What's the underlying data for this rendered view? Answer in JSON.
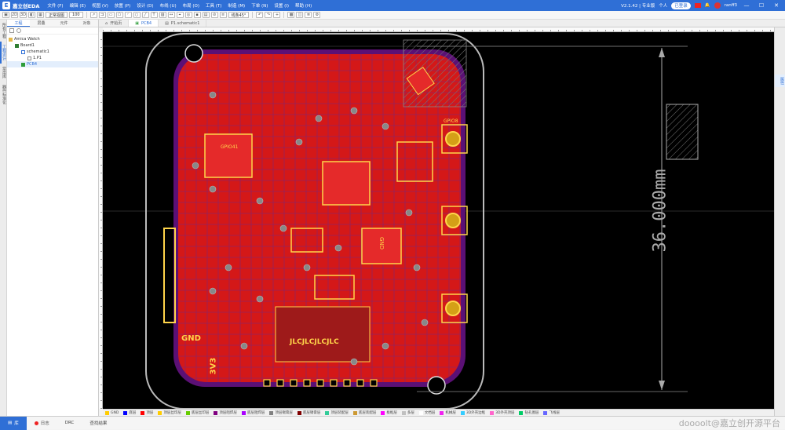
{
  "app": {
    "name": "嘉立创EDA",
    "menu": [
      "文件 (F)",
      "编辑 (E)",
      "视图 (V)",
      "放置 (P)",
      "设计 (D)",
      "布线 (U)",
      "布局 (O)",
      "工具 (T)",
      "制造 (M)",
      "下单 (N)",
      "设置 (I)",
      "帮助 (H)"
    ],
    "version": "V2.1.42 | 专业版",
    "mode": "个人",
    "cloud": "已登录",
    "username": "ranff3"
  },
  "toolbar": {
    "view_select": "正常视图",
    "zoom_select": "100",
    "angle_select": "线条45°"
  },
  "left_panel": {
    "vertical_tabs": [
      "所有工程",
      "工程设计",
      "常用库",
      "器件标准化"
    ],
    "tabs": [
      "工程",
      "层叠",
      "元件",
      "对象"
    ],
    "tree": [
      {
        "label": "Amica Watch",
        "indent": 0
      },
      {
        "label": "Board1",
        "indent": 1
      },
      {
        "label": "schematic1",
        "indent": 2
      },
      {
        "label": "1.P1",
        "indent": 3
      },
      {
        "label": "PCB4",
        "indent": 2
      }
    ]
  },
  "doc_tabs": [
    "开始页",
    "PCB4",
    "P1.schematic1"
  ],
  "right_strip": {
    "tab": "属性"
  },
  "canvas": {
    "dimension_label": "36.000mm",
    "silk_texts": [
      "GND",
      "3V3",
      "JLCJLCJLCJLC",
      "GPIO8",
      "GPIO41",
      "GND"
    ]
  },
  "layers": [
    {
      "name": "GND",
      "color": "#ffcc00"
    },
    {
      "name": "底层",
      "color": "#0000ff"
    },
    {
      "name": "顶层",
      "color": "#ff0000"
    },
    {
      "name": "顶层丝印层",
      "color": "#ffcc00"
    },
    {
      "name": "底层丝印层",
      "color": "#66cc00"
    },
    {
      "name": "顶层阻焊层",
      "color": "#800080"
    },
    {
      "name": "底层阻焊层",
      "color": "#aa00ff"
    },
    {
      "name": "顶层锡膏层",
      "color": "#808080"
    },
    {
      "name": "底层锡膏层",
      "color": "#800000"
    },
    {
      "name": "顶层装配层",
      "color": "#33cc99"
    },
    {
      "name": "底层装配层",
      "color": "#cc9933"
    },
    {
      "name": "板框层",
      "color": "#ff00ff"
    },
    {
      "name": "多层",
      "color": "#c0c0c0"
    },
    {
      "name": "文档层",
      "color": "#ffffff"
    },
    {
      "name": "机械层",
      "color": "#f022f0"
    },
    {
      "name": "3D外壳边框",
      "color": "#33ccff"
    },
    {
      "name": "3D外壳顶层",
      "color": "#ff66cc"
    },
    {
      "name": "钻孔图层",
      "color": "#00cc66"
    },
    {
      "name": "飞线层",
      "color": "#6666ff"
    }
  ],
  "status_bar": {
    "items": [
      "库",
      "日志",
      "DRC",
      "查找结果"
    ],
    "watermark": "doooolt@嘉立创开源平台"
  }
}
